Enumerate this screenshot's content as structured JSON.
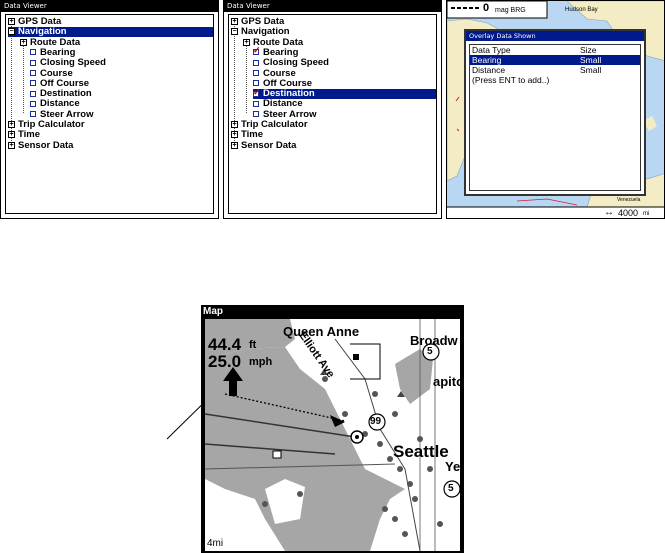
{
  "panel1": {
    "title": "Data Viewer",
    "items": [
      {
        "sym": "+",
        "label": "GPS Data"
      },
      {
        "sym": "−",
        "label": "Navigation"
      },
      {
        "sym": "+",
        "label": "Route Data"
      },
      {
        "label": "Bearing"
      },
      {
        "label": "Closing Speed"
      },
      {
        "label": "Course"
      },
      {
        "label": "Off Course"
      },
      {
        "label": "Destination"
      },
      {
        "label": "Distance"
      },
      {
        "label": "Steer Arrow"
      },
      {
        "sym": "+",
        "label": "Trip Calculator"
      },
      {
        "sym": "+",
        "label": "Time"
      },
      {
        "sym": "+",
        "label": "Sensor Data"
      }
    ]
  },
  "panel2": {
    "title": "Data Viewer",
    "items": [
      {
        "sym": "+",
        "label": "GPS Data"
      },
      {
        "sym": "−",
        "label": "Navigation"
      },
      {
        "sym": "+",
        "label": "Route Data"
      },
      {
        "label": "Bearing",
        "checked": true
      },
      {
        "label": "Closing Speed"
      },
      {
        "label": "Course"
      },
      {
        "label": "Off Course"
      },
      {
        "label": "Destination",
        "checked": true
      },
      {
        "label": "Distance"
      },
      {
        "label": "Steer Arrow"
      },
      {
        "sym": "+",
        "label": "Trip Calculator"
      },
      {
        "sym": "+",
        "label": "Time"
      },
      {
        "sym": "+",
        "label": "Sensor Data"
      }
    ]
  },
  "panel3": {
    "overlay_value": "0",
    "overlay_label": "mag BRG",
    "place": "Hudson Bay",
    "dialog_title": "Overlay Data Shown",
    "col_type": "Data Type",
    "col_size": "Size",
    "rows": [
      {
        "type": "Bearing",
        "size": "Small"
      },
      {
        "type": "Distance",
        "size": "Small"
      },
      {
        "type": "(Press ENT to add..)",
        "size": ""
      }
    ],
    "scale": "4000",
    "scale_unit": "mi",
    "map_label": "Venezuela"
  },
  "map": {
    "title": "Map",
    "depth_value": "44.4",
    "depth_unit": "ft",
    "speed_value": "25.0",
    "speed_unit": "mph",
    "places": [
      "Queen Anne",
      "Elliott Ave",
      "Broadw",
      "apito",
      "Seattle",
      "Ye"
    ],
    "shields": [
      "5",
      "99",
      "5"
    ],
    "scale": "4mi"
  },
  "colors": {
    "highlight": "#001a8c",
    "check": "#cc0000",
    "water": "#b9d7f2",
    "land": "#f3ecc4",
    "map_water": "#a6a6a6"
  }
}
